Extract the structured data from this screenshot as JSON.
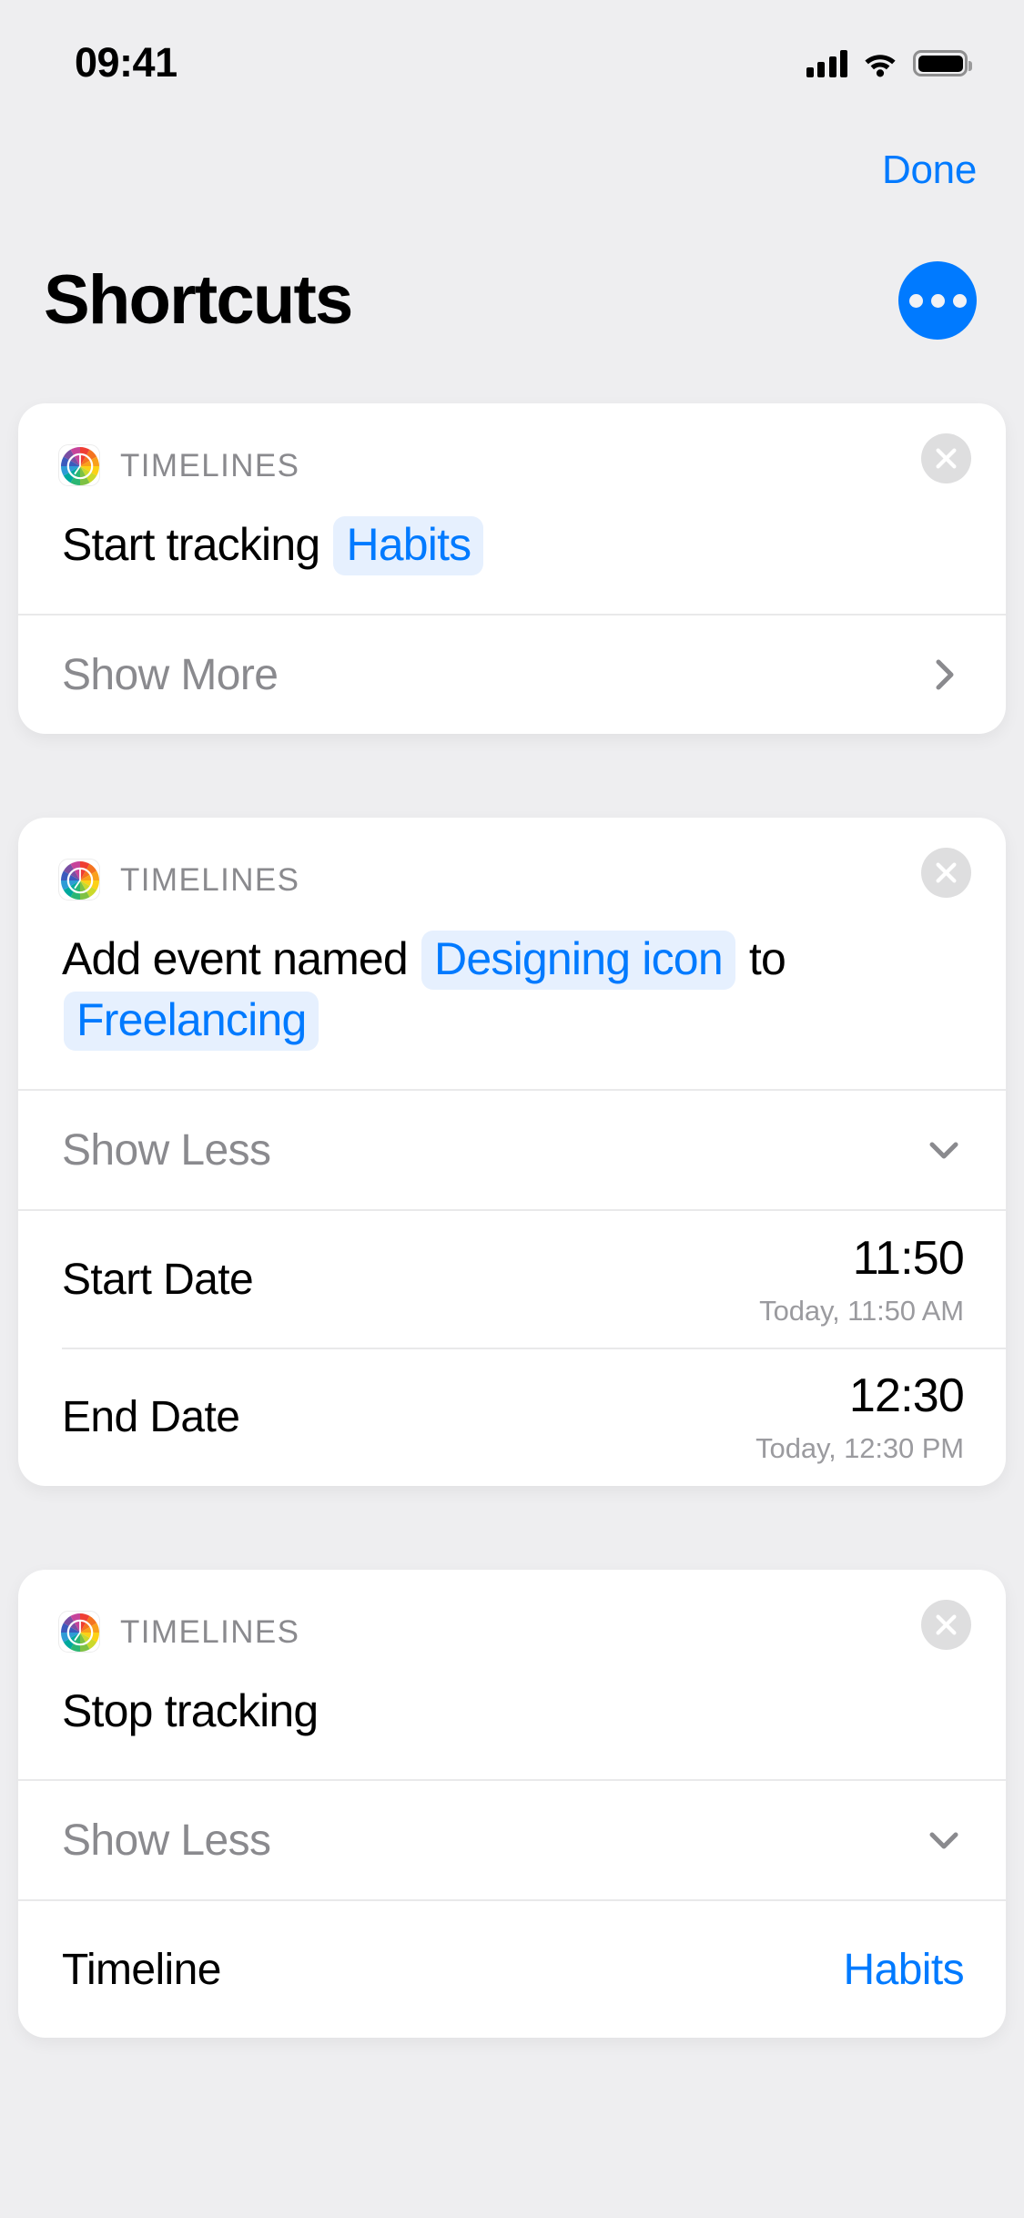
{
  "status_bar": {
    "time": "09:41",
    "cellular_icon": "cellular-signal-icon",
    "wifi_icon": "wifi-icon",
    "battery_icon": "battery-full-icon"
  },
  "nav": {
    "done_label": "Done",
    "title": "Shortcuts",
    "more_icon": "ellipsis-icon"
  },
  "colors": {
    "accent": "#007AFF",
    "token_bg": "#E6F0FE",
    "page_bg": "#EEEEF0",
    "card_bg": "#FFFFFF",
    "secondary_text": "#8A8A8E",
    "tertiary_text": "#9B9B9F",
    "separator": "#E9E9EA",
    "close_button_bg": "#DEDEDF"
  },
  "cards": [
    {
      "app_name": "TIMELINES",
      "app_icon": "timelines-color-wheel-icon",
      "close_icon": "close-circle-icon",
      "statement": [
        {
          "type": "text",
          "value": "Start tracking "
        },
        {
          "type": "token",
          "value": "Habits"
        }
      ],
      "disclosure": {
        "label": "Show More",
        "icon": "chevron-right-icon",
        "expanded": false
      },
      "details": []
    },
    {
      "app_name": "TIMELINES",
      "app_icon": "timelines-color-wheel-icon",
      "close_icon": "close-circle-icon",
      "statement": [
        {
          "type": "text",
          "value": "Add event named "
        },
        {
          "type": "token",
          "value": "Designing icon"
        },
        {
          "type": "text",
          "value": " to "
        },
        {
          "type": "token",
          "value": "Freelancing"
        }
      ],
      "disclosure": {
        "label": "Show Less",
        "icon": "chevron-down-icon",
        "expanded": true
      },
      "details": [
        {
          "label": "Start Date",
          "value": "11:50",
          "sub": "Today, 11:50 AM",
          "style": "stacked"
        },
        {
          "label": "End Date",
          "value": "12:30",
          "sub": "Today, 12:30 PM",
          "style": "stacked"
        }
      ]
    },
    {
      "app_name": "TIMELINES",
      "app_icon": "timelines-color-wheel-icon",
      "close_icon": "close-circle-icon",
      "statement": [
        {
          "type": "text",
          "value": "Stop tracking"
        }
      ],
      "disclosure": {
        "label": "Show Less",
        "icon": "chevron-down-icon",
        "expanded": true
      },
      "details": [
        {
          "label": "Timeline",
          "value": "Habits",
          "sub": "",
          "style": "link"
        }
      ]
    }
  ]
}
